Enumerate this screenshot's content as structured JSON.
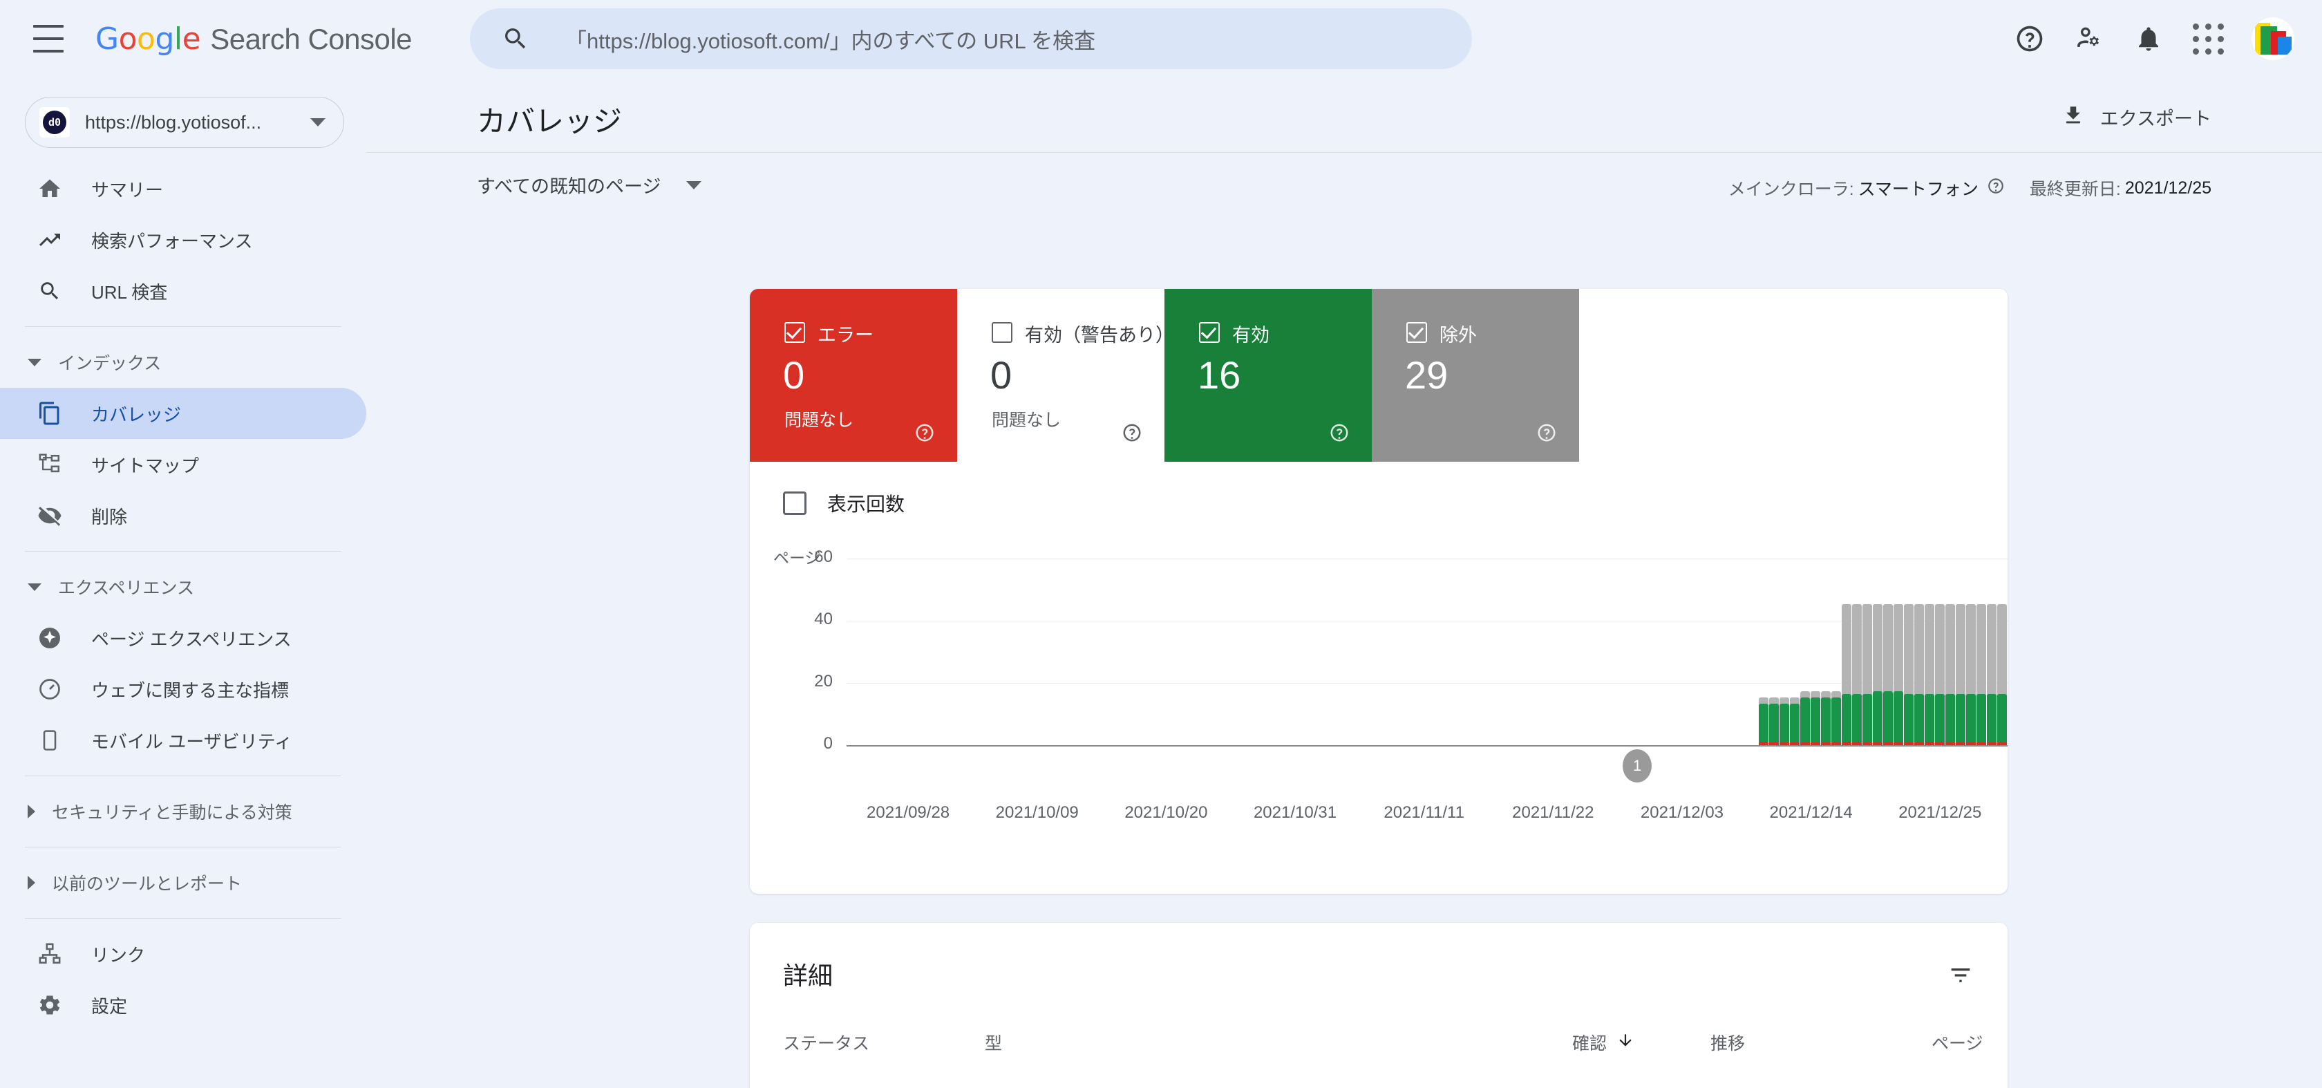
{
  "topbar": {
    "menu_icon": "hamburger-icon",
    "brand_google": "Google",
    "brand_product": "Search Console",
    "search": {
      "icon": "search-icon",
      "placeholder": "「https://blog.yotiosoft.com/」内のすべての URL を検査",
      "value": ""
    },
    "icons": {
      "help": "help-icon",
      "account_settings": "account-settings-icon",
      "notifications": "notifications-bell-icon",
      "apps": "apps-grid-icon",
      "avatar": "user-avatar"
    }
  },
  "sidebar": {
    "property": {
      "favicon_text": "d0",
      "label": "https://blog.yotiosof...",
      "caret": "chevron-down-icon"
    },
    "top_items": [
      {
        "label": "サマリー",
        "icon": "home-icon",
        "active": false
      },
      {
        "label": "検索パフォーマンス",
        "icon": "trending-up-icon",
        "active": false
      },
      {
        "label": "URL 検査",
        "icon": "search-icon",
        "active": false
      }
    ],
    "group_index": {
      "label": "インデックス",
      "expanded": true,
      "items": [
        {
          "label": "カバレッジ",
          "icon": "pages-copy-icon",
          "active": true
        },
        {
          "label": "サイトマップ",
          "icon": "sitemap-icon",
          "active": false
        },
        {
          "label": "削除",
          "icon": "eye-off-icon",
          "active": false
        }
      ]
    },
    "group_experience": {
      "label": "エクスペリエンス",
      "expanded": true,
      "items": [
        {
          "label": "ページ エクスペリエンス",
          "icon": "sparkle-badge-icon",
          "active": false
        },
        {
          "label": "ウェブに関する主な指標",
          "icon": "speed-gauge-icon",
          "active": false
        },
        {
          "label": "モバイル ユーザビリティ",
          "icon": "mobile-phone-icon",
          "active": false
        }
      ]
    },
    "group_security": {
      "label": "セキュリティと手動による対策",
      "expanded": false
    },
    "group_legacy": {
      "label": "以前のツールとレポート",
      "expanded": false
    },
    "bottom_items": [
      {
        "label": "リンク",
        "icon": "links-hierarchy-icon"
      },
      {
        "label": "設定",
        "icon": "gear-icon"
      }
    ]
  },
  "page": {
    "title": "カバレッジ",
    "export_label": "エクスポート",
    "export_icon": "download-icon",
    "filter_label": "すべての既知のページ",
    "filter_caret": "chevron-down-icon",
    "crawler_key": "メインクローラ:",
    "crawler_value": "スマートフォン",
    "crawler_help_icon": "help-circle-icon",
    "updated_key": "最終更新日:",
    "updated_value": "2021/12/25"
  },
  "status_cards": [
    {
      "name": "エラー",
      "count": "0",
      "sub": "問題なし",
      "checked": true,
      "color": "#d93025",
      "help_icon": "help-circle-icon"
    },
    {
      "name": "有効（警告あり）",
      "count": "0",
      "sub": "問題なし",
      "checked": false,
      "color": "#ffffff",
      "help_icon": "help-circle-icon"
    },
    {
      "name": "有効",
      "count": "16",
      "sub": "",
      "checked": true,
      "color": "#188038",
      "help_icon": "help-circle-icon"
    },
    {
      "name": "除外",
      "count": "29",
      "sub": "",
      "checked": true,
      "color": "#919191",
      "help_icon": "help-circle-icon"
    }
  ],
  "chart_controls": {
    "impressions_label": "表示回数",
    "impressions_checked": false
  },
  "chart_data": {
    "type": "bar",
    "title": "",
    "ylabel": "ページ",
    "xlabel": "",
    "stacked": true,
    "grid": true,
    "ylim": [
      0,
      60
    ],
    "yticks": [
      0,
      20,
      40,
      60
    ],
    "ytick_labels": [
      "0",
      "20",
      "40",
      "60"
    ],
    "xtick_labels": [
      "2021/09/28",
      "2021/10/09",
      "2021/10/20",
      "2021/10/31",
      "2021/11/11",
      "2021/11/22",
      "2021/12/03",
      "2021/12/14",
      "2021/12/25"
    ],
    "xtick_positions": [
      0.0185,
      0.1296,
      0.2407,
      0.3518,
      0.4629,
      0.574,
      0.6851,
      0.7962,
      0.9073
    ],
    "legend": [
      "エラー",
      "有効（警告あり）",
      "有効",
      "除外"
    ],
    "series": [
      {
        "name": "エラー",
        "color": "#e02b20",
        "values": [
          0,
          0,
          0,
          0,
          0,
          0,
          0,
          0,
          0,
          0,
          0,
          0,
          0,
          0,
          0,
          0,
          0,
          0,
          0,
          0,
          0,
          0,
          0,
          0,
          0,
          0,
          0,
          0,
          0,
          0,
          0,
          0,
          0,
          0,
          0,
          0,
          0,
          0,
          0,
          0,
          0,
          0,
          0,
          0,
          0,
          0,
          0,
          0,
          0,
          0,
          0,
          0,
          0,
          0,
          0,
          0,
          0,
          0,
          0,
          0,
          0,
          0,
          0,
          0,
          0,
          0,
          0,
          0,
          0,
          0,
          0,
          0,
          0,
          0,
          0,
          0,
          0,
          0,
          0,
          0,
          0,
          0,
          0,
          0,
          0,
          0,
          0,
          0,
          0.4,
          0.4,
          0.4,
          0.4,
          0.4,
          0.4,
          0.4,
          0.4,
          0.4,
          0.4,
          0.4,
          0.4,
          0.4,
          0.4,
          0.4,
          0.4,
          0.4,
          0.4,
          0.4,
          0.4,
          0.4,
          0.4,
          0.4,
          0.4
        ]
      },
      {
        "name": "有効",
        "color": "#189548",
        "values": [
          0,
          0,
          0,
          0,
          0,
          0,
          0,
          0,
          0,
          0,
          0,
          0,
          0,
          0,
          0,
          0,
          0,
          0,
          0,
          0,
          0,
          0,
          0,
          0,
          0,
          0,
          0,
          0,
          0,
          0,
          0,
          0,
          0,
          0,
          0,
          0,
          0,
          0,
          0,
          0,
          0,
          0,
          0,
          0,
          0,
          0,
          0,
          0,
          0,
          0,
          0,
          0,
          0,
          0,
          0,
          0,
          0,
          0,
          0,
          0,
          0,
          0,
          0,
          0,
          0,
          0,
          0,
          0,
          0,
          0,
          0,
          0,
          0,
          0,
          0,
          0,
          0,
          0,
          0,
          0,
          0,
          0,
          0,
          0,
          0,
          0,
          0,
          0,
          13,
          13,
          13,
          13,
          15,
          15,
          15,
          15,
          16,
          16,
          16,
          17,
          17,
          17,
          16,
          16,
          16,
          16,
          16,
          16,
          16,
          16,
          16,
          16
        ]
      },
      {
        "name": "除外",
        "color": "#b4b4b4",
        "values": [
          0,
          0,
          0,
          0,
          0,
          0,
          0,
          0,
          0,
          0,
          0,
          0,
          0,
          0,
          0,
          0,
          0,
          0,
          0,
          0,
          0,
          0,
          0,
          0,
          0,
          0,
          0,
          0,
          0,
          0,
          0,
          0,
          0,
          0,
          0,
          0,
          0,
          0,
          0,
          0,
          0,
          0,
          0,
          0,
          0,
          0,
          0,
          0,
          0,
          0,
          0,
          0,
          0,
          0,
          0,
          0,
          0,
          0,
          0,
          0,
          0,
          0,
          0,
          0,
          0,
          0,
          0,
          0,
          0,
          0,
          0,
          0,
          0,
          0,
          0,
          0,
          0,
          0,
          0,
          0,
          0,
          0,
          0,
          0,
          0,
          0,
          0,
          0,
          2,
          2,
          2,
          2,
          2,
          2,
          2,
          2,
          29,
          29,
          29,
          28,
          28,
          28,
          29,
          29,
          29,
          29,
          29,
          29,
          29,
          29,
          29,
          29
        ]
      }
    ],
    "annotations": [
      {
        "label": "1",
        "x_fraction": 0.681
      }
    ]
  },
  "details": {
    "title": "詳細",
    "filter_icon": "filter-list-icon",
    "columns": [
      {
        "label": "ステータス"
      },
      {
        "label": "型"
      },
      {
        "label": "確認",
        "sort_icon": "arrow-down-icon"
      },
      {
        "label": "推移"
      },
      {
        "label": "ページ"
      }
    ],
    "rows": []
  },
  "colors": {
    "page_bg": "#eef2fa",
    "card_bg": "#ffffff",
    "error": "#d93025",
    "valid": "#188038",
    "excluded": "#919191",
    "accent": "#174ea6",
    "active_nav_bg": "#c9d8f7",
    "search_bg": "#dbe5f8"
  }
}
